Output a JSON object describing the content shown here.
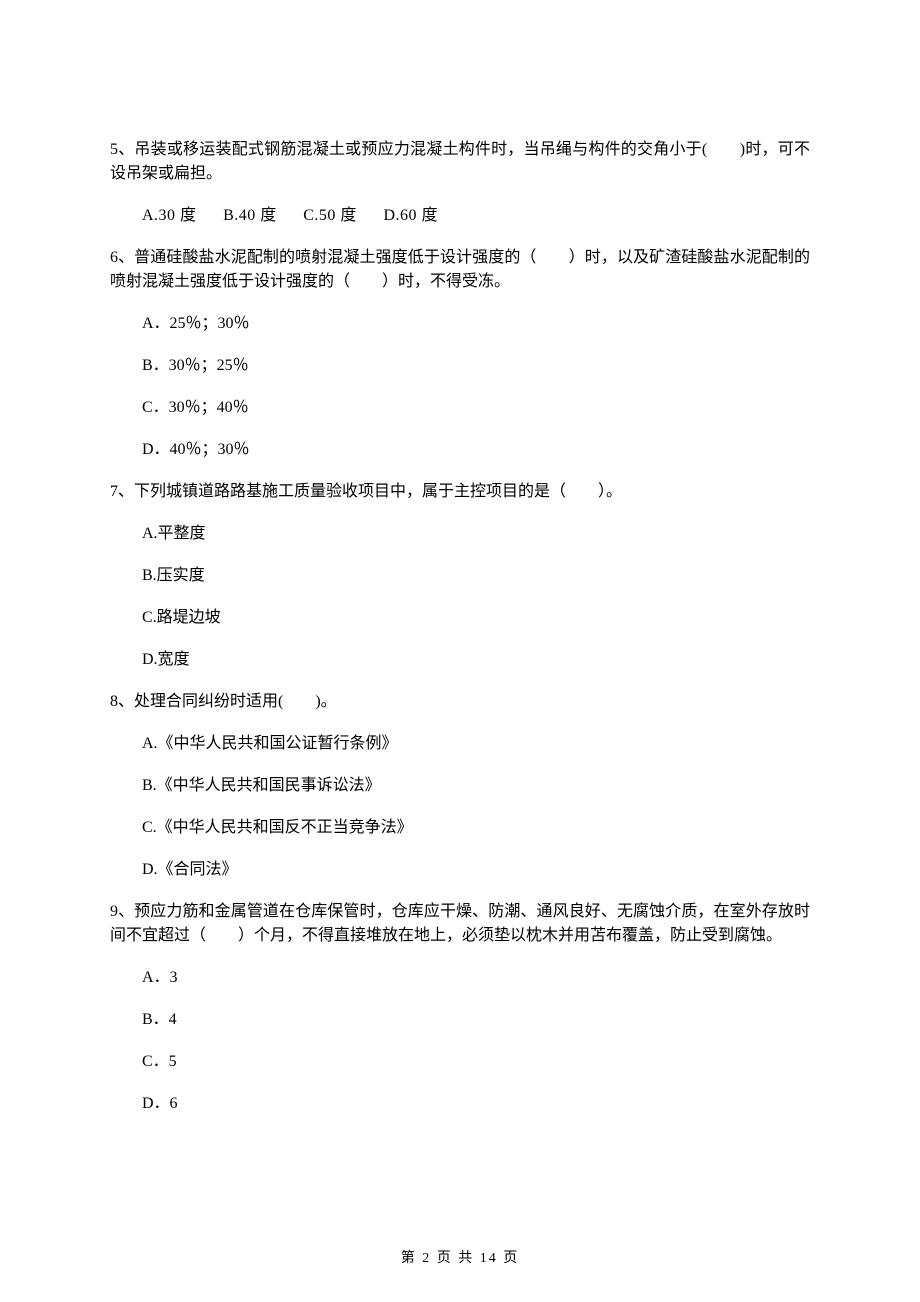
{
  "questions": [
    {
      "stem": "5、吊装或移运装配式钢筋混凝土或预应力混凝土构件时，当吊绳与构件的交角小于(　　)时，可不设吊架或扁担。",
      "options_inline": [
        "A.30 度",
        "B.40 度",
        "C.50 度",
        "D.60 度"
      ]
    },
    {
      "stem": "6、普通硅酸盐水泥配制的喷射混凝土强度低于设计强度的（　　）时，以及矿渣硅酸盐水泥配制的喷射混凝土强度低于设计强度的（　　）时，不得受冻。",
      "options_block": [
        "A．25％；30％",
        "B．30％；25％",
        "C．30％；40％",
        "D．40％；30％"
      ]
    },
    {
      "stem": "7、下列城镇道路路基施工质量验收项目中，属于主控项目的是（　　）。",
      "options_block": [
        "A.平整度",
        "B.压实度",
        "C.路堤边坡",
        "D.宽度"
      ]
    },
    {
      "stem": "8、处理合同纠纷时适用(　　)。",
      "options_block": [
        "A.《中华人民共和国公证暂行条例》",
        "B.《中华人民共和国民事诉讼法》",
        "C.《中华人民共和国反不正当竞争法》",
        "D.《合同法》"
      ]
    },
    {
      "stem": "9、预应力筋和金属管道在仓库保管时，仓库应干燥、防潮、通风良好、无腐蚀介质，在室外存放时间不宜超过（　　）个月，不得直接堆放在地上，必须垫以枕木并用苫布覆盖，防止受到腐蚀。",
      "options_block": [
        "A．3",
        "B．4",
        "C．5",
        "D．6"
      ]
    }
  ],
  "footer": "第 2 页 共 14 页"
}
